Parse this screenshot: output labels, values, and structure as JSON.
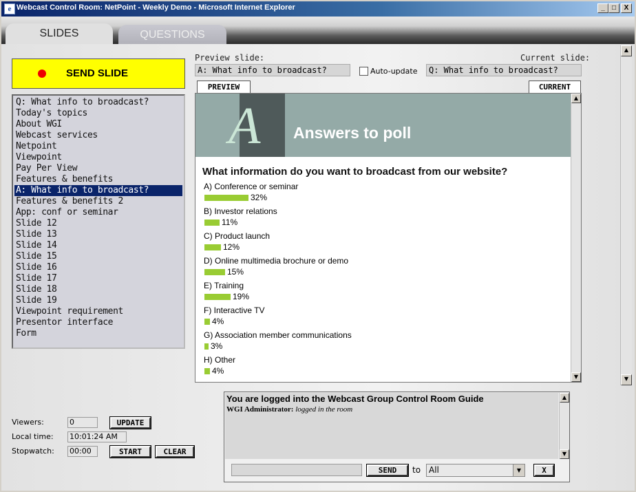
{
  "window": {
    "title": "Webcast Control Room: NetPoint - Weekly Demo - Microsoft Internet Explorer",
    "minimize": "_",
    "maximize": "□",
    "close": "X"
  },
  "tabs": {
    "slides": "SLIDES",
    "questions": "QUESTIONS"
  },
  "send_slide": {
    "label": "SEND SLIDE",
    "dot_color": "#ee0000"
  },
  "slides": {
    "items": [
      "Q: What info to broadcast?",
      "Today's topics",
      "About WGI",
      "Webcast services",
      "Netpoint",
      "Viewpoint",
      "Pay Per View",
      "Features & benefits",
      "A: What info to broadcast?",
      "Features & benefits 2",
      "App: conf or seminar",
      "Slide 12",
      "Slide 13",
      "Slide 14",
      "Slide 15",
      "Slide 16",
      "Slide 17",
      "Slide 18",
      "Slide 19",
      "Viewpoint requirement",
      "Presentor interface",
      "Form"
    ],
    "selected_index": 8
  },
  "preview": {
    "preview_label": "Preview slide:",
    "preview_value": "A: What info to broadcast?",
    "auto_update_label": "Auto-update",
    "current_label": "Current slide:",
    "current_value": "Q: What info to broadcast?",
    "tab_preview": "PREVIEW",
    "tab_current": "CURRENT"
  },
  "slide_content": {
    "logo_letter": "A",
    "header_title": "Answers to poll",
    "question": "What information do you want to broadcast from our website?",
    "bar_color": "#99cc33",
    "answers": [
      {
        "label": "A) Conference or seminar",
        "pct": "32%",
        "value": 32
      },
      {
        "label": "B) Investor relations",
        "pct": "11%",
        "value": 11
      },
      {
        "label": "C) Product launch",
        "pct": "12%",
        "value": 12
      },
      {
        "label": "D) Online multimedia brochure or demo",
        "pct": "15%",
        "value": 15
      },
      {
        "label": "E) Training",
        "pct": "19%",
        "value": 19
      },
      {
        "label": "F) Interactive TV",
        "pct": "4%",
        "value": 4
      },
      {
        "label": "G) Association member communications",
        "pct": "3%",
        "value": 3
      },
      {
        "label": "H) Other",
        "pct": "4%",
        "value": 4
      }
    ]
  },
  "stats": {
    "viewers_label": "Viewers:",
    "viewers_value": "0",
    "update_button": "UPDATE",
    "local_time_label": "Local time:",
    "local_time_value": "10:01:24 AM",
    "stopwatch_label": "Stopwatch:",
    "stopwatch_value": "00:00",
    "start_button": "START",
    "clear_button": "CLEAR"
  },
  "chat": {
    "header": "You are logged into the Webcast Group Control Room Guide",
    "line_name": "WGI Administrator:",
    "line_text": "logged in the room",
    "send_button": "SEND",
    "to_label": "to",
    "to_value": "All",
    "close_button": "X"
  }
}
